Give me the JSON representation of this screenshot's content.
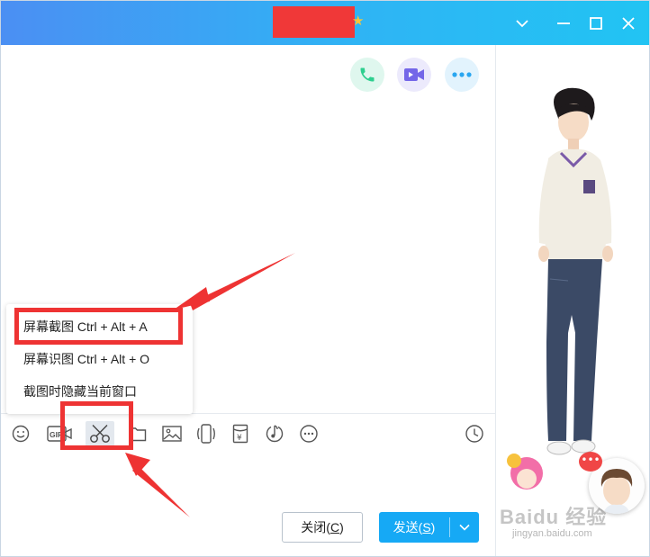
{
  "colors": {
    "titlebar_start": "#4b8ff3",
    "titlebar_end": "#21c4f3",
    "send_button": "#16a9f5",
    "annotation_red": "#ee3333",
    "phone_green": "#2ecf8f",
    "video_purple": "#7466e8",
    "more_blue": "#2aa6f0"
  },
  "titlebar": {
    "minimize_icon": "minimize-icon",
    "maximize_icon": "maximize-icon",
    "close_icon": "close-icon"
  },
  "header_actions": {
    "voice_call_icon": "phone-icon",
    "video_call_icon": "video-camera-icon",
    "more_icon": "more-dots-icon"
  },
  "screenshot_menu": {
    "items": [
      {
        "label": "屏幕截图 Ctrl + Alt + A"
      },
      {
        "label": "屏幕识图 Ctrl + Alt + O"
      },
      {
        "label": "截图时隐藏当前窗口"
      }
    ]
  },
  "toolbar": {
    "icons": [
      "smiley-icon",
      "gif-icon",
      "video-icon",
      "scissors-icon",
      "folder-icon",
      "image-icon",
      "shake-icon",
      "red-packet-icon",
      "music-icon",
      "more-icon",
      "history-clock-icon"
    ],
    "gif_text": "GIF"
  },
  "buttons": {
    "close_label": "关闭(",
    "close_key": "C",
    "close_suffix": ")",
    "send_label": "发送(",
    "send_key": "S",
    "send_suffix": ")"
  },
  "side_panel": {
    "watermark": "Baidu 经验",
    "watermark_url": "jingyan.baidu.com",
    "badge": "•••"
  }
}
